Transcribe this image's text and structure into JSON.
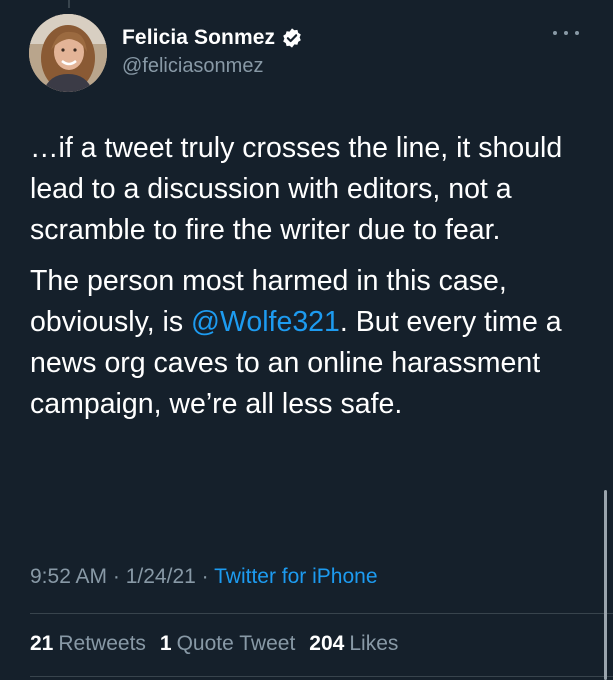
{
  "author": {
    "display_name": "Felicia Sonmez",
    "handle": "@feliciasonmez",
    "verified": true
  },
  "tweet": {
    "paragraph1": "…if a tweet truly crosses the line, it should lead to a discussion with editors, not a scramble to fire the writer due to fear.",
    "paragraph2_before": "The person most harmed in this case, obviously, is ",
    "mention": "@Wolfe321",
    "paragraph2_after": ". But every time a news org caves to an online harassment campaign, we’re all less safe."
  },
  "meta": {
    "time": "9:52 AM",
    "sep1": " · ",
    "date": "1/24/21",
    "sep2": " · ",
    "source": "Twitter for iPhone"
  },
  "stats": {
    "retweets_count": "21",
    "retweets_label": "Retweets",
    "quote_count": "1",
    "quote_label": "Quote Tweet",
    "likes_count": "204",
    "likes_label": "Likes"
  },
  "icons": {
    "verified": "verified-badge-icon",
    "more": "more-horizontal-icon"
  },
  "colors": {
    "background": "#15202b",
    "text": "#ffffff",
    "secondary": "#8899a6",
    "link": "#1d9bf0",
    "divider": "#38444d"
  }
}
